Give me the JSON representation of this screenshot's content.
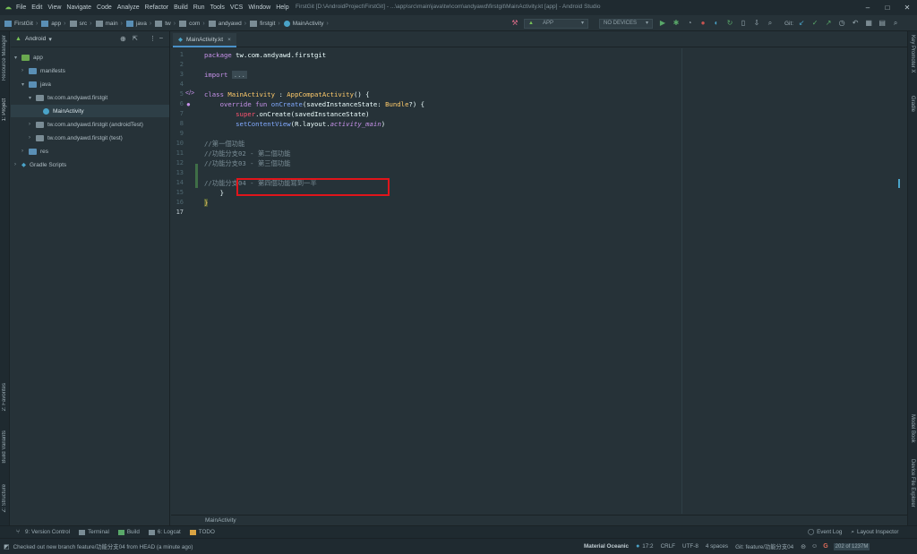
{
  "menubar": {
    "items": [
      "File",
      "Edit",
      "View",
      "Navigate",
      "Code",
      "Analyze",
      "Refactor",
      "Build",
      "Run",
      "Tools",
      "VCS",
      "Window",
      "Help"
    ],
    "title": "FirstGit [D:\\AndroidProject\\FirstGit] - ...\\app\\src\\main\\java\\tw\\com\\andyawd\\firstgit\\MainActivity.kt [app] - Android Studio",
    "min": "–",
    "max": "□",
    "close": "✕"
  },
  "breadcrumb": {
    "items": [
      "FirstGit",
      "app",
      "src",
      "main",
      "java",
      "tw",
      "com",
      "andyawd",
      "firstgit",
      "MainActivity"
    ]
  },
  "toolbar": {
    "config": "APP",
    "devices": "NO DEVICES",
    "git_label": "Git:"
  },
  "project": {
    "view": "Android",
    "tree": [
      {
        "label": "app"
      },
      {
        "label": "manifests"
      },
      {
        "label": "java"
      },
      {
        "label": "tw.com.andyawd.firstgit"
      },
      {
        "label": "MainActivity"
      },
      {
        "label": "tw.com.andyawd.firstgit (androidTest)"
      },
      {
        "label": "tw.com.andyawd.firstgit (test)"
      },
      {
        "label": "res"
      },
      {
        "label": "Gradle Scripts"
      }
    ]
  },
  "left_tools": {
    "resource_manager": "Resource Manager",
    "project": "1: Project",
    "favorites": "2: Favorites",
    "build_variants": "Build Variants",
    "structure": "Z: Structure"
  },
  "right_tools": {
    "key_promoter": "Key Promoter X",
    "gradle": "Gradle",
    "model_book": "Model Book",
    "device_explorer": "Device File Explorer"
  },
  "editor": {
    "tab": "MainActivity.kt",
    "footer": "MainActivity",
    "line_numbers": [
      "1",
      "2",
      "3",
      "4",
      "5",
      "6",
      "7",
      "8",
      "9",
      "10",
      "11",
      "12",
      "13",
      "14",
      "15",
      "16",
      "17"
    ],
    "lines": {
      "l1_kw": "package",
      "l1_rest": " tw.com.andyawd.firstgit",
      "l3_kw": "import",
      "l3_rest": "...",
      "l6_kw": "class",
      "l6_name": " MainActivity",
      "l6_rest": " : ",
      "l6_parent": "AppCompatActivity",
      "l6_tail": "() {",
      "l7_kw": "override fun",
      "l7_name": " onCreate",
      "l7_rest": "(savedInstanceState: ",
      "l7_type": "Bundle",
      "l7_tail": "?) {",
      "l8_kw": "super",
      "l8_rest": ".onCreate(savedInstanceState)",
      "l9_fn": "setContentView",
      "l9_rest": "(R.layout.",
      "l9_it": "activity_main",
      "l9_tail": ")",
      "l11": "//第一個功能",
      "l12": "//功能分支02 - 第二個功能",
      "l13": "//功能分支03 - 第三個功能",
      "l15": "//功能分支04 - 第四個功能寫到一半",
      "l16": "}",
      "l17": "}"
    }
  },
  "bottom_tools": [
    "9: Version Control",
    "Terminal",
    "Build",
    "6: Logcat",
    "TODO"
  ],
  "bottom_right_tools": [
    "Event Log",
    "Layout Inspector"
  ],
  "status": {
    "message": "Checked out new branch feature/功能分支04 from HEAD (a minute ago)",
    "theme": "Material Oceanic",
    "position": "17:2",
    "line_sep": "CRLF",
    "encoding": "UTF-8",
    "indent": "4 spaces",
    "branch": "Git: feature/功能分支04",
    "memory": "202 of 1237M"
  },
  "colors": {
    "background": "#263238",
    "highlight_box": "#e0151b",
    "keyword": "#C792EA",
    "function": "#82AAFF"
  }
}
